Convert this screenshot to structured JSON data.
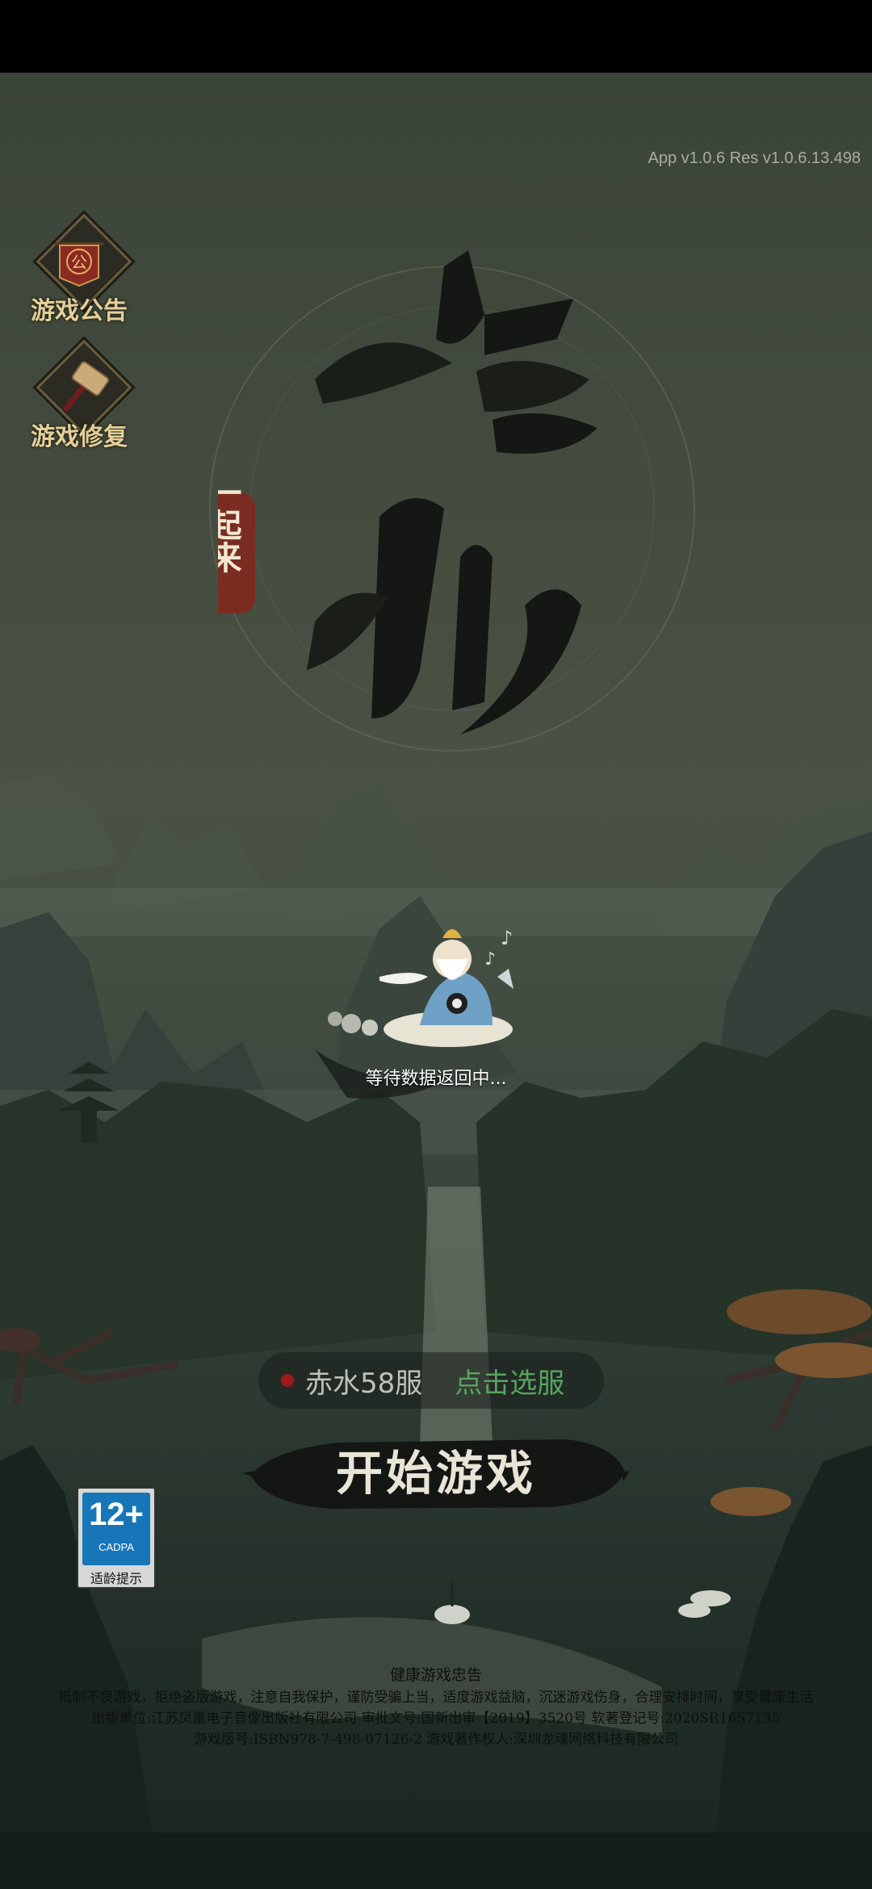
{
  "app": {
    "version": "App v1.0.6 Res v1.0.6.13.498"
  },
  "side_buttons": [
    {
      "label": "游戏公告",
      "icon": "notice-flag-icon",
      "icon_text": "公"
    },
    {
      "label": "游戏修复",
      "icon": "repair-hammer-icon"
    }
  ],
  "title": {
    "main_1": "修",
    "main_2": "仙",
    "seal": "一起来"
  },
  "loading": {
    "text": "等待数据返回中..."
  },
  "server": {
    "name": "赤水58服",
    "select_label": "点击选服",
    "status_color": "#9e1a1a"
  },
  "start": {
    "label": "开始游戏"
  },
  "age_rating": {
    "age": "12+",
    "org": "CADPA",
    "tip": "适龄提示"
  },
  "notice": {
    "title": "健康游戏忠告",
    "line1": "抵制不良游戏，拒绝盗版游戏，注意自我保护，谨防受骗上当，适度游戏益脑，沉迷游戏伤身，合理安排时间，享受健康生活",
    "line2": "出版单位:江苏凤凰电子音像出版社有限公司  审批文号:国新出审【2019】3520号  软著登记号:2020SR1657135",
    "line3": "游戏版号:ISBN978-7-498-07126-2  游戏著作权人:深圳龙魂网络科技有限公司"
  }
}
